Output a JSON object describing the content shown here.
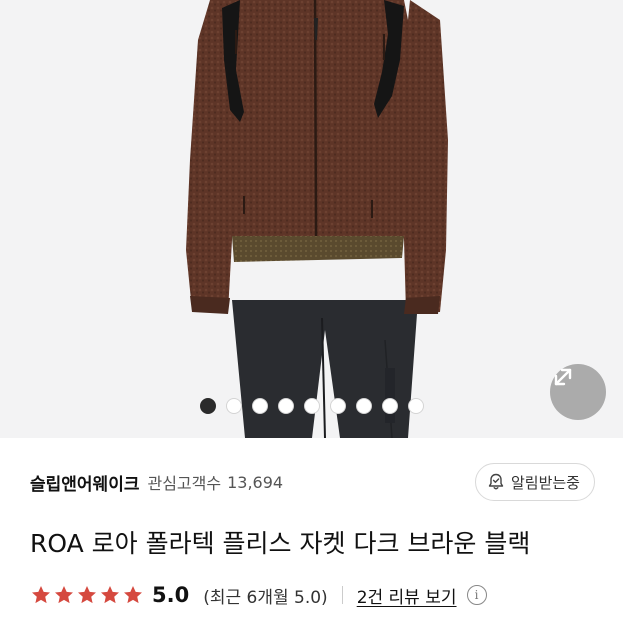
{
  "product_image": {
    "carousel_total": 9,
    "carousel_active_index": 0
  },
  "store": {
    "name": "슬립앤어웨이크",
    "follower_label": "관심고객수",
    "follower_count": "13,694",
    "alarm_button": "알림받는중"
  },
  "product": {
    "title": "ROA 로아 폴라텍 플리스 자켓 다크 브라운 블랙"
  },
  "rating": {
    "stars": 5,
    "score": "5.0",
    "period_text": "(최근 6개월 5.0)",
    "review_link": "2건 리뷰 보기",
    "info_symbol": "i"
  },
  "colors": {
    "star": "#d5493f",
    "jacket": "#5e3527",
    "pants": "#2a2c30",
    "background": "#f3f3f4"
  },
  "icons": {
    "expand": "expand-arrows-icon",
    "alarm": "bell-check-icon",
    "star": "star-icon",
    "info": "info-icon"
  }
}
